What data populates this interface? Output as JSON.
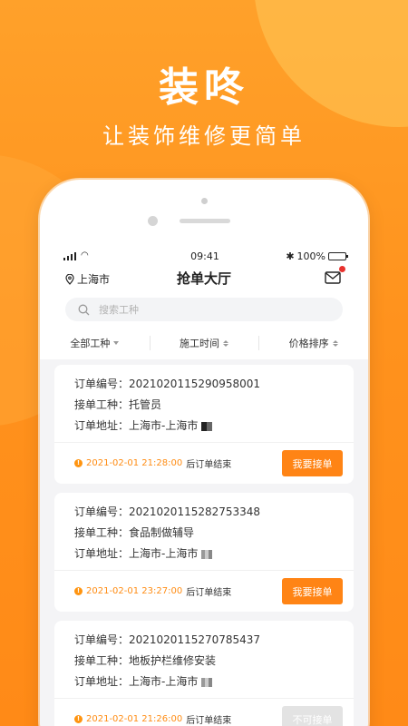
{
  "promo": {
    "brand": "装咚",
    "slogan": "让装饰维修更简单"
  },
  "statusbar": {
    "time": "09:41",
    "battery": "100%"
  },
  "navbar": {
    "location": "上海市",
    "title": "抢单大厅"
  },
  "search": {
    "placeholder": "搜索工种"
  },
  "filters": [
    {
      "label": "全部工种",
      "icon": "caret-down-icon"
    },
    {
      "label": "施工时间",
      "icon": "sort-icon"
    },
    {
      "label": "价格排序",
      "icon": "sort-icon"
    }
  ],
  "orders": [
    {
      "order_no": "订单编号：2021020115290958001",
      "work_type": "接单工种：托管员",
      "address": "订单地址：上海市-上海市",
      "deadline_time": "2021-02-01 21:28:00",
      "deadline_suffix": "后订单结束",
      "button": "我要接单",
      "button_enabled": true
    },
    {
      "order_no": "订单编号：2021020115282753348",
      "work_type": "接单工种：食品制做辅导",
      "address": "订单地址：上海市-上海市",
      "deadline_time": "2021-02-01 23:27:00",
      "deadline_suffix": "后订单结束",
      "button": "我要接单",
      "button_enabled": true
    },
    {
      "order_no": "订单编号：2021020115270785437",
      "work_type": "接单工种：地板护栏维修安装",
      "address": "订单地址：上海市-上海市",
      "deadline_time": "2021-02-01 21:26:00",
      "deadline_suffix": "后订单结束",
      "button": "不可接单",
      "button_enabled": false
    }
  ],
  "colors": {
    "accent": "#ff8415",
    "background": "#ff921d",
    "disabled": "#e3e3e3"
  }
}
